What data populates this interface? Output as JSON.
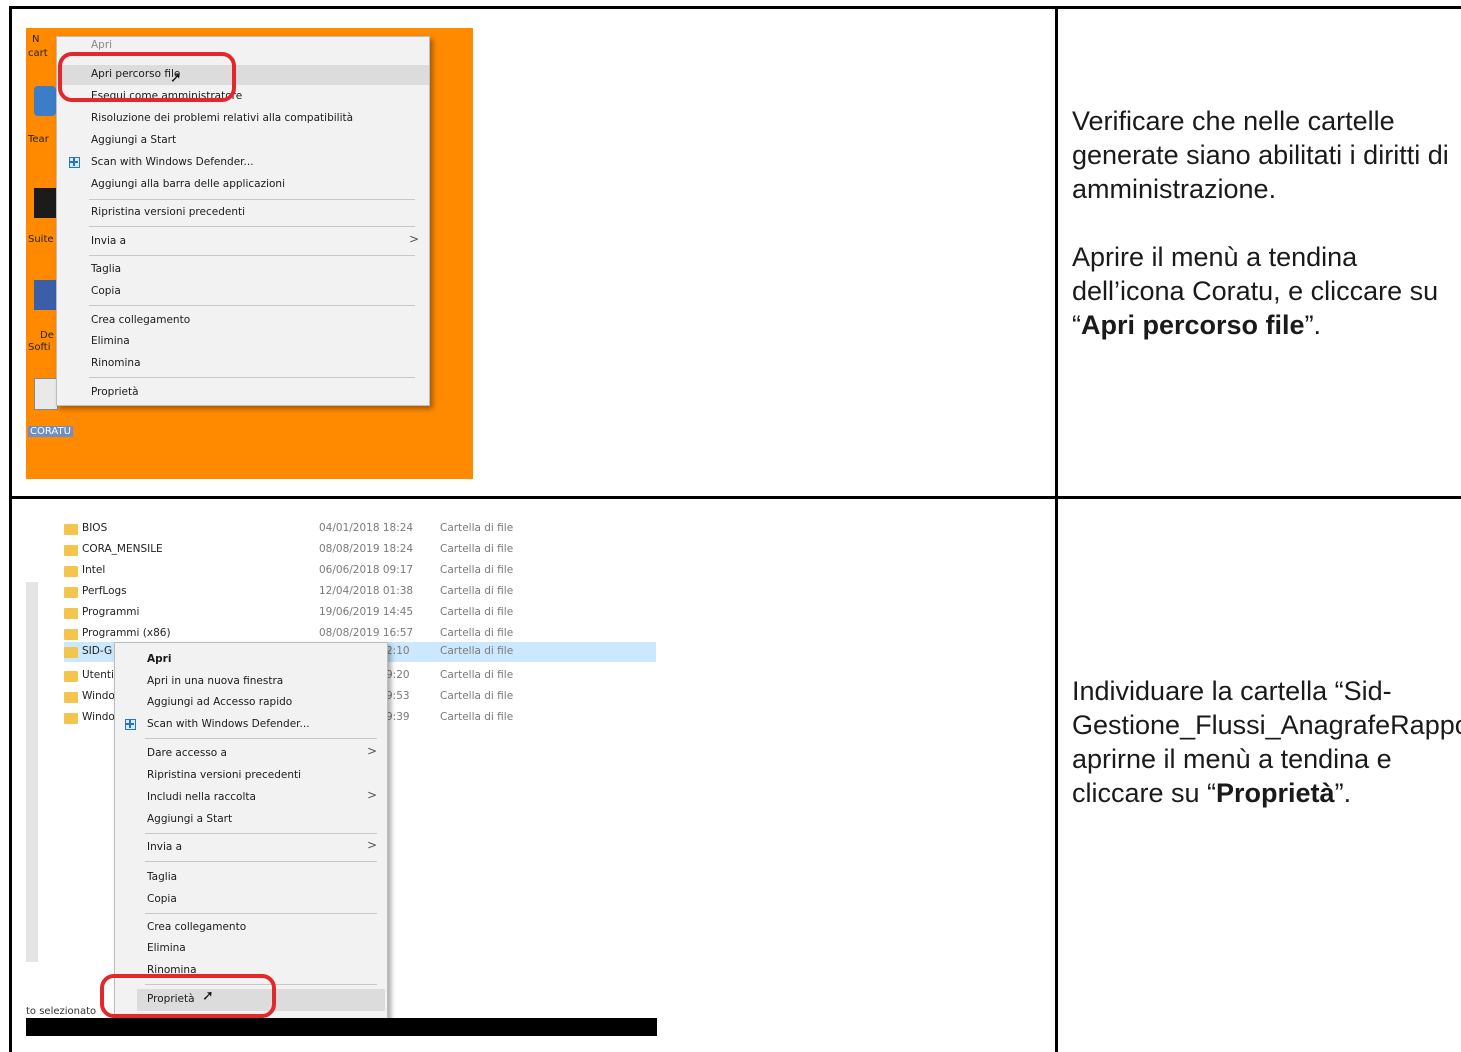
{
  "row1": {
    "screenshot": {
      "desktop_labels": [
        "N",
        "cart",
        "Tear",
        "Suite",
        "De",
        "Softi",
        "CORATU"
      ],
      "menu_items": [
        {
          "label": "Apri"
        },
        {
          "label": "Apri percorso file"
        },
        {
          "label": "Esegui come amministratore"
        },
        {
          "label": "Risoluzione dei problemi relativi alla compatibilità"
        },
        {
          "label": "Aggiungi a Start"
        },
        {
          "label": "Scan with Windows Defender..."
        },
        {
          "label": "Aggiungi alla barra delle applicazioni"
        },
        {
          "label": "Ripristina versioni precedenti"
        },
        {
          "label": "Invia a"
        },
        {
          "label": "Taglia"
        },
        {
          "label": "Copia"
        },
        {
          "label": "Crea collegamento"
        },
        {
          "label": "Elimina"
        },
        {
          "label": "Rinomina"
        },
        {
          "label": "Proprietà"
        }
      ],
      "submenu_arrow": ">"
    },
    "instructions": {
      "p1": "Verificare che nelle cartelle generate siano abilitati i diritti di amministrazione.",
      "p2_prefix": "Aprire il menù a tendina dell’icona Coratu, e cliccare su “",
      "p2_bold": "Apri percorso file",
      "p2_suffix": "”."
    }
  },
  "row2": {
    "screenshot": {
      "files": [
        {
          "name": "BIOS",
          "date": "04/01/2018 18:24",
          "type": "Cartella di file"
        },
        {
          "name": "CORA_MENSILE",
          "date": "08/08/2019 18:24",
          "type": "Cartella di file"
        },
        {
          "name": "Intel",
          "date": "06/06/2018 09:17",
          "type": "Cartella di file"
        },
        {
          "name": "PerfLogs",
          "date": "12/04/2018 01:38",
          "type": "Cartella di file"
        },
        {
          "name": "Programmi",
          "date": "19/06/2019 14:45",
          "type": "Cartella di file"
        },
        {
          "name": "Programmi (x86)",
          "date": "08/08/2019 16:57",
          "type": "Cartella di file"
        },
        {
          "name": "SID-G",
          "date": "2:10",
          "type": "Cartella di file"
        },
        {
          "name": "Utenti",
          "date": "9:20",
          "type": "Cartella di file"
        },
        {
          "name": "Windo",
          "date": "9:53",
          "type": "Cartella di file"
        },
        {
          "name": "Windo",
          "date": "9:39",
          "type": "Cartella di file"
        }
      ],
      "menu_items": [
        {
          "label": "Apri"
        },
        {
          "label": "Apri in una nuova finestra"
        },
        {
          "label": "Aggiungi ad Accesso rapido"
        },
        {
          "label": "Scan with Windows Defender..."
        },
        {
          "label": "Dare accesso a"
        },
        {
          "label": "Ripristina versioni precedenti"
        },
        {
          "label": "Includi nella raccolta"
        },
        {
          "label": "Aggiungi a Start"
        },
        {
          "label": "Invia a"
        },
        {
          "label": "Taglia"
        },
        {
          "label": "Copia"
        },
        {
          "label": "Crea collegamento"
        },
        {
          "label": "Elimina"
        },
        {
          "label": "Rinomina"
        },
        {
          "label": "Proprietà"
        }
      ],
      "status_text": "to selezionato",
      "submenu_arrow": ">"
    },
    "instructions": {
      "p1_prefix": "Individuare la cartella “Sid-Gestione_Flussi_AnagrafeRapporti”, aprirne il menù a tendina e cliccare su “",
      "p1_bold": "Proprietà",
      "p1_suffix": "”."
    }
  }
}
